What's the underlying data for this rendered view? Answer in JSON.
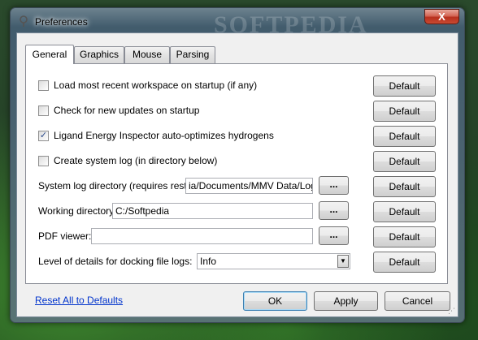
{
  "window": {
    "title": "Preferences",
    "close_glyph": "X",
    "watermark": "SOFTPEDIA"
  },
  "tabs": [
    {
      "label": "General",
      "active": true
    },
    {
      "label": "Graphics",
      "active": false
    },
    {
      "label": "Mouse",
      "active": false
    },
    {
      "label": "Parsing",
      "active": false
    }
  ],
  "checkboxes": [
    {
      "label": "Load most recent workspace on startup (if any)",
      "checked": false,
      "mark": ""
    },
    {
      "label": "Check for new updates on startup",
      "checked": false,
      "mark": ""
    },
    {
      "label": "Ligand Energy Inspector auto-optimizes hydrogens",
      "checked": true,
      "mark": "✓"
    },
    {
      "label": "Create system log (in directory below)",
      "checked": false,
      "mark": ""
    }
  ],
  "fields": {
    "system_log": {
      "label": "System log directory (requires restart):",
      "value": "ia/Documents/MMV Data/Logs"
    },
    "working_dir": {
      "label": "Working directory:",
      "value": "C:/Softpedia"
    },
    "pdf_viewer": {
      "label": "PDF viewer:",
      "value": ""
    },
    "docking_logs": {
      "label": "Level of details for docking file logs:",
      "value": "Info"
    }
  },
  "browse_label": "...",
  "default_label": "Default",
  "footer": {
    "reset_link": "Reset All to Defaults",
    "ok": "OK",
    "apply": "Apply",
    "cancel": "Cancel"
  }
}
